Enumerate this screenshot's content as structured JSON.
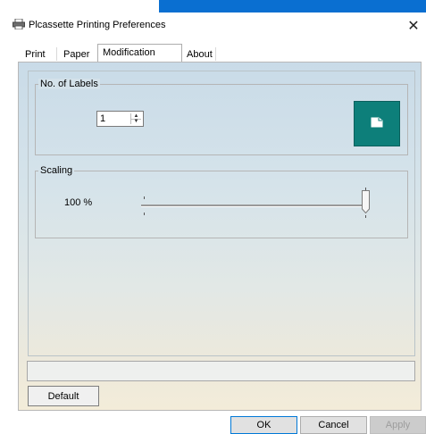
{
  "window": {
    "title": "Plcassette Printing Preferences",
    "close_glyph": "✕"
  },
  "tabs": [
    {
      "label": "Print",
      "active": false
    },
    {
      "label": "Paper",
      "active": false
    },
    {
      "label": "Modification",
      "active": true
    },
    {
      "label": "About",
      "active": false
    }
  ],
  "labels_group": {
    "title": "No. of Labels",
    "count_value": "1",
    "preview_color": "#0d7f7a",
    "preview_icon": "document-icon"
  },
  "scaling_group": {
    "title": "Scaling",
    "value_text": "100 %",
    "slider_position_fraction": 1.0
  },
  "status_bar": {
    "text": ""
  },
  "buttons": {
    "default_label": "Default",
    "ok_label": "OK",
    "cancel_label": "Cancel",
    "apply_label": "Apply"
  },
  "colors": {
    "accent": "#0a6fd1",
    "ok_border": "#0078d7"
  }
}
